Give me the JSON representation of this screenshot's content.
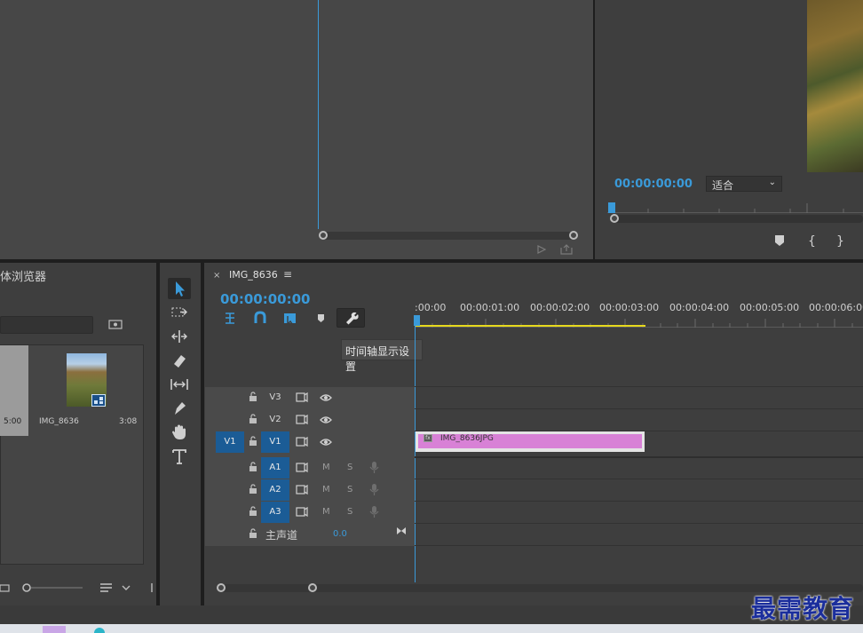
{
  "source_monitor": {},
  "program_monitor": {
    "timecode": "00:00:00:00",
    "fit_label": "适合",
    "buttons": [
      "add-marker",
      "mark-in",
      "mark-out"
    ]
  },
  "media_browser": {
    "title": "体浏览器",
    "items": [
      {
        "name": "",
        "duration": "5:00"
      },
      {
        "name": "IMG_8636",
        "duration": "3:08"
      }
    ]
  },
  "tools": [
    "selection-tool",
    "track-select-tool",
    "ripple-edit-tool",
    "razor-tool",
    "slip-tool",
    "pen-tool",
    "hand-tool",
    "type-tool"
  ],
  "timeline": {
    "close_glyph": "×",
    "sequence_name": "IMG_8636",
    "menu_glyph": "≡",
    "timecode": "00:00:00:00",
    "tooltip": "时间轴显示设置",
    "ruler_labels": [
      ":00:00",
      "00:00:01:00",
      "00:00:02:00",
      "00:00:03:00",
      "00:00:04:00",
      "00:00:05:00",
      "00:00:06:00"
    ],
    "video_tracks": [
      {
        "name": "V3",
        "source_patch": ""
      },
      {
        "name": "V2",
        "source_patch": ""
      },
      {
        "name": "V1",
        "source_patch": "V1"
      }
    ],
    "audio_tracks": [
      {
        "name": "A1",
        "m": "M",
        "s": "S"
      },
      {
        "name": "A2",
        "m": "M",
        "s": "S"
      },
      {
        "name": "A3",
        "m": "M",
        "s": "S"
      }
    ],
    "master": {
      "label": "主声道",
      "value": "0.0"
    },
    "clip": {
      "name": "IMG_8636JPG",
      "badge": "fx",
      "color": "#d881d6"
    }
  },
  "watermark": "最需教育",
  "colors": {
    "accent": "#3a9ad9",
    "work_area": "#e6d81c",
    "clip": "#d881d6",
    "patch": "#1b5c96"
  }
}
